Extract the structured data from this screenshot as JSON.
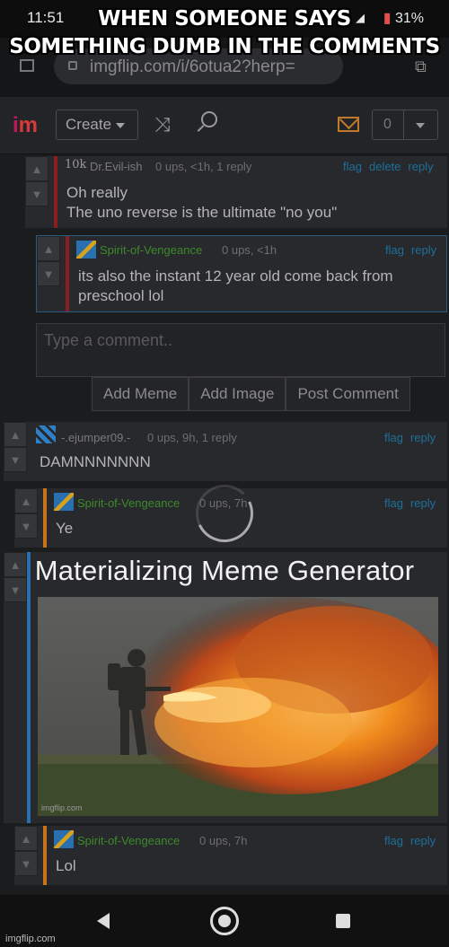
{
  "caption": {
    "line1": "WHEN SOMEONE SAYS",
    "line2": "SOMETHING DUMB IN THE COMMENTS"
  },
  "status_bar": {
    "time": "11:51",
    "battery": "31%"
  },
  "browser": {
    "url": "imgflip.com/i/6otua2?herp="
  },
  "nav": {
    "create_label": "Create",
    "notif_count": "0"
  },
  "comments": [
    {
      "author": "Dr.Evil-ish",
      "badge": "10k",
      "meta": "0 ups, <1h, 1 reply",
      "actions": [
        "flag",
        "delete",
        "reply"
      ],
      "body": [
        "Oh really",
        "The uno reverse is the ultimate \"no you\""
      ]
    },
    {
      "author": "Spirit-of-Vengeance",
      "meta": "0 ups, <1h",
      "actions": [
        "flag",
        "reply"
      ],
      "body": [
        "its also the instant 12 year old come back from",
        "preschool lol"
      ]
    },
    {
      "author": "-.ejumper09.-",
      "meta": "0 ups, 9h, 1 reply",
      "actions": [
        "flag",
        "reply"
      ],
      "body": [
        "DAMNNNNNNN"
      ]
    },
    {
      "author": "Spirit-of-Vengeance",
      "meta": "0 ups, 7h",
      "actions": [
        "flag",
        "reply"
      ],
      "body": [
        "Ye"
      ]
    },
    {
      "author": "Spirit-of-Vengeance",
      "meta": "0 ups, 7h",
      "actions": [
        "flag",
        "reply"
      ],
      "body": [
        "Lol"
      ]
    }
  ],
  "reply_box": {
    "placeholder": "Type a comment..",
    "buttons": [
      "Add Meme",
      "Add Image",
      "Post Comment"
    ]
  },
  "overlay": {
    "text": "Materializing Meme Generator"
  },
  "image": {
    "watermark": "imgflip.com"
  },
  "footer": {
    "watermark": "imgflip.com"
  },
  "colors": {
    "author_green": "#3c8a2a",
    "link_blue": "#1e6f9a",
    "bar_red": "#8b1e1e",
    "bar_orange": "#c8741c",
    "bar_blue": "#2a6fb0"
  }
}
